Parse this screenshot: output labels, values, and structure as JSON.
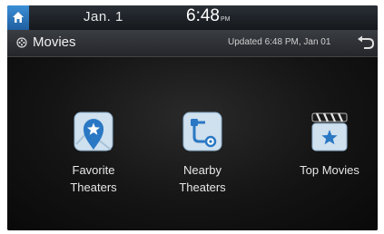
{
  "status_bar": {
    "date": "Jan.  1",
    "time": "6:48",
    "ampm": "PM"
  },
  "title_bar": {
    "title": "Movies",
    "updated": "Updated 6:48 PM, Jan 01"
  },
  "menu": [
    {
      "label_line1": "Favorite",
      "label_line2": "Theaters",
      "icon": "map-pin-star-icon"
    },
    {
      "label_line1": "Nearby",
      "label_line2": "Theaters",
      "icon": "route-icon"
    },
    {
      "label_line1": "Top Movies",
      "label_line2": "",
      "icon": "clapperboard-star-icon"
    }
  ],
  "colors": {
    "accent_blue": "#2a78c4",
    "icon_bg_light": "#cfe0ee"
  }
}
